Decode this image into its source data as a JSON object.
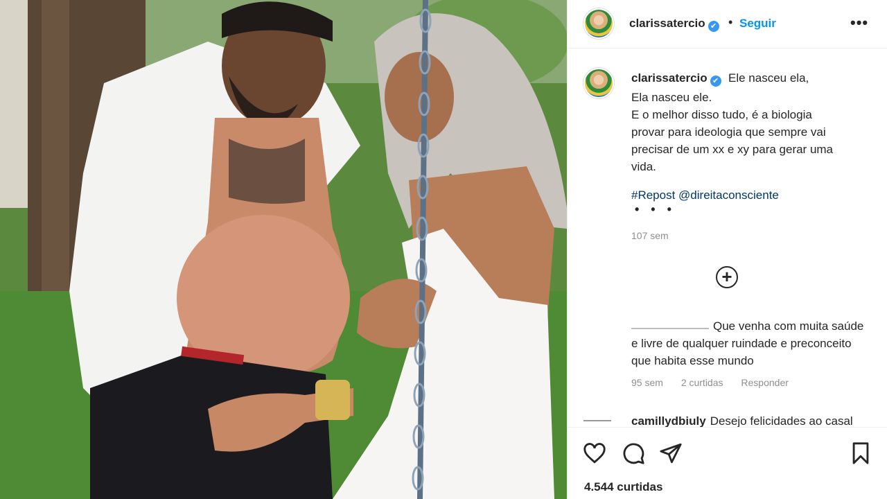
{
  "post": {
    "username": "clarissatercio",
    "verified_mark": "✔",
    "separator": "•",
    "follow_label": "Seguir",
    "more_label": "•••"
  },
  "caption": {
    "username": "clarissatercio",
    "first_line": "Ele nasceu ela,",
    "lines": [
      "Ela nasceu ele.",
      "E o melhor disso tudo, é a biologia",
      "provar para ideologia que sempre vai",
      "precisar de um xx e xy para gerar uma",
      "vida."
    ],
    "hashtag": "#Repost @direitaconsciente",
    "dots": "• • •",
    "time": "107 sem"
  },
  "load_more_icon": "plus-circle-icon",
  "comments": [
    {
      "text": "Que venha com muita saúde e livre de qualquer ruindade e preconceito que habita esse mundo",
      "time": "95 sem",
      "likes": "2 curtidas",
      "reply_label": "Responder"
    },
    {
      "username": "camillydbiuly",
      "text": "Desejo felicidades ao casal"
    }
  ],
  "actions": {
    "icons": [
      "heart-icon",
      "comment-icon",
      "share-icon",
      "bookmark-icon"
    ],
    "likes_text": "4.544 curtidas"
  },
  "colors": {
    "link_blue": "#0095f6",
    "hashtag_blue": "#00376b",
    "muted_gray": "#8e8e8e",
    "text": "#262626"
  }
}
